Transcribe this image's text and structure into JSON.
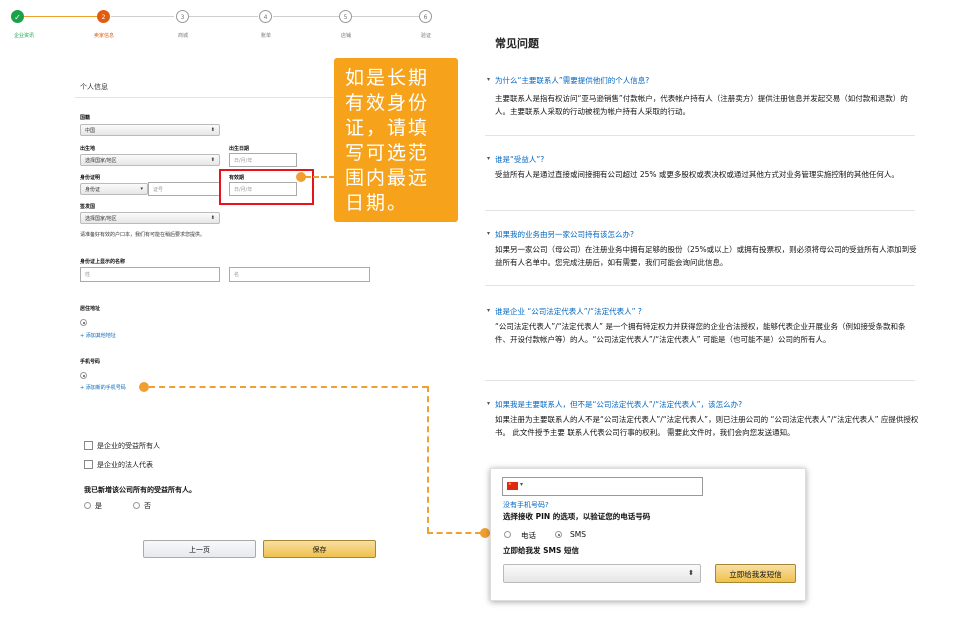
{
  "steps": [
    {
      "num": "✓",
      "label": "企业资讯",
      "state": "done"
    },
    {
      "num": "2",
      "label": "卖家信息",
      "state": "current"
    },
    {
      "num": "3",
      "label": "商城",
      "state": "todo"
    },
    {
      "num": "4",
      "label": "账单",
      "state": "todo"
    },
    {
      "num": "5",
      "label": "店铺",
      "state": "todo"
    },
    {
      "num": "6",
      "label": "验证",
      "state": "todo"
    }
  ],
  "form": {
    "section_title": "个人信息",
    "nationality_label": "国籍",
    "nationality_value": "中国",
    "birthplace_label": "出生地",
    "birthplace_value": "选择国家/地区",
    "dob_label": "出生日期",
    "dob_placeholder": "日/月/年",
    "id_label": "身份证明",
    "id_type_value": "身份证",
    "id_number_placeholder": "证号",
    "expiry_label": "有效期",
    "expiry_placeholder": "日/月/年",
    "issuer_label": "签发国",
    "issuer_value": "选择国家/地区",
    "hukou_note": "请准备好有效的户口本，我们有可能在稍后要求您提供。",
    "name_on_id_label": "身份证上显示的名称",
    "last_name_placeholder": "姓",
    "first_name_placeholder": "名",
    "residence_label": "居住地址",
    "add_address_link": "+ 添加其他地址",
    "phone_label": "手机号码",
    "add_phone_link": "+ 添加新的手机号码",
    "checkbox_beneficiary": "是企业的受益所有人",
    "checkbox_legal_rep": "是企业的法人代表",
    "question_all_added": "我已新增该公司所有的受益所有人。",
    "answer_yes": "是",
    "answer_no": "否",
    "prev_button": "上一页",
    "save_button": "保存"
  },
  "callout": {
    "text": "如是长期有效身份证，请填写可选范围内最远日期。",
    "bg_color": "#f7a21b"
  },
  "faq": {
    "title": "常见问题",
    "items": [
      {
        "q": "为什么“主要联系人”需要提供他们的个人信息?",
        "a": "主要联系人是指有权访问“亚马逊销售”付款帐户，代表帐户持有人（注册卖方）提供注册信息并发起交易（如付款和退款）的人。主要联系人采取的行动被视为帐户持有人采取的行动。"
      },
      {
        "q": "谁是“受益人”?",
        "a": "受益所有人是通过直接或间接拥有公司超过 25% 或更多股权或表决权或通过其他方式对业务管理实施控制的其他任何人。"
      },
      {
        "q": "如果我的业务由另一家公司持有该怎么办?",
        "a": "如果另一家公司（母公司）在注册业务中拥有足够的股份（25%或以上）或拥有投票权，则必须将母公司的受益所有人添加到受益所有人名单中。您完成注册后，如有需要，我们可能会询问此信息。"
      },
      {
        "q": "谁是企业 “公司法定代表人”/“法定代表人” ?",
        "a": "“公司法定代表人”/“法定代表人” 是一个拥有特定权力并获得您的企业合法授权，能够代表企业开展业务（例如接受条款和条件、开设付款帐户等）的人。“公司法定代表人”/“法定代表人” 可能是（也可能不是）公司的所有人。"
      },
      {
        "q": "如果我是主要联系人，但不是“公司法定代表人”/“法定代表人”，该怎么办?",
        "a": "如果注册为主要联系人的人不是“公司法定代表人”/“法定代表人”，则已注册公司的 “公司法定代表人”/“法定代表人” 应提供授权书。 此文件授予主要 联系人代表公司行事的权利。 需要此文件时，我们会向您发送通知。"
      }
    ]
  },
  "phone_popup": {
    "no_phone_link": "没有手机号码?",
    "pin_title": "选择接收 PIN 的选项，以验证您的电话号码",
    "option_call": "电话",
    "option_sms": "SMS",
    "sms_title": "立即给我发 SMS 短信",
    "send_button": "立即给我发短信"
  }
}
